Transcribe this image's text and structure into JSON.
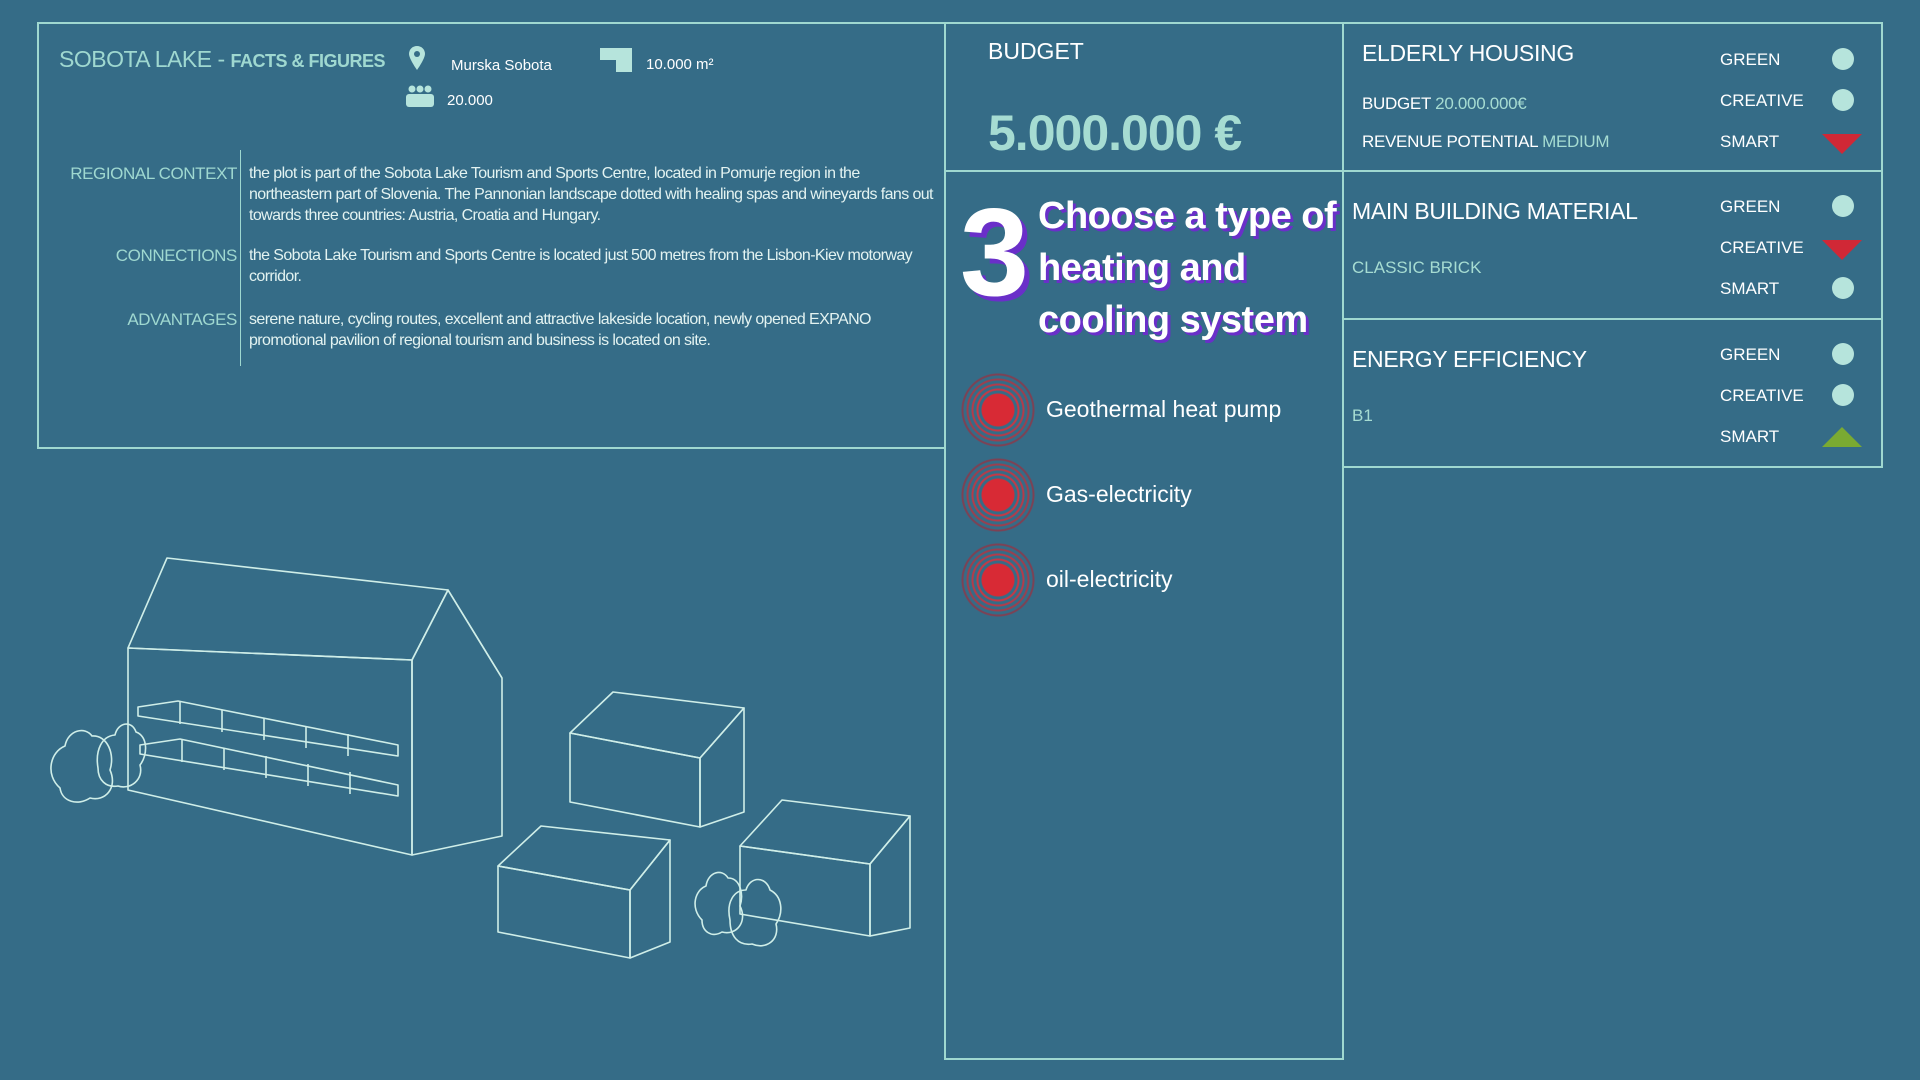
{
  "facts": {
    "title_main": "SOBOTA LAKE",
    "title_sep": " - ",
    "title_sub": "FACTS & FIGURES",
    "location": "Murska Sobota",
    "area": "10.000 m²",
    "population": "20.000",
    "rows": [
      {
        "label": "REGIONAL CONTEXT",
        "text": "the plot is part of the Sobota Lake Tourism and Sports Centre, located in Pomurje region in the northeastern part of Slovenia. The Pannonian landscape dotted with healing spas and wineyards fans out towards three countries: Austria, Croatia and Hungary."
      },
      {
        "label": "CONNECTIONS",
        "text": "the Sobota Lake Tourism and Sports Centre is located just 500 metres from the Lisbon-Kiev motorway corridor."
      },
      {
        "label": "ADVANTAGES",
        "text": "serene nature, cycling routes, excellent and attractive lakeside location, newly opened EXPANO promotional pavilion of regional tourism and business is located on site."
      }
    ]
  },
  "budget": {
    "label": "BUDGET",
    "value": "5.000.000 €"
  },
  "step": {
    "number": "3",
    "title": "Choose a type of heating and cooling system",
    "options": [
      "Geothermal heat pump",
      "Gas-electricity",
      "oil-electricity"
    ]
  },
  "housing": {
    "title": "ELDERLY HOUSING",
    "budget_label": "BUDGET",
    "budget_value": "20.000.000€",
    "revenue_label": "REVENUE POTENTIAL",
    "revenue_value": "MEDIUM",
    "indicators": [
      {
        "label": "GREEN",
        "state": "neutral"
      },
      {
        "label": "CREATIVE",
        "state": "neutral"
      },
      {
        "label": "SMART",
        "state": "down"
      }
    ]
  },
  "material": {
    "title": "MAIN BUILDING MATERIAL",
    "value": "CLASSIC BRICK",
    "indicators": [
      {
        "label": "GREEN",
        "state": "neutral"
      },
      {
        "label": "CREATIVE",
        "state": "down"
      },
      {
        "label": "SMART",
        "state": "neutral"
      }
    ]
  },
  "energy": {
    "title": "ENERGY EFFICIENCY",
    "value": "B1",
    "indicators": [
      {
        "label": "GREEN",
        "state": "neutral"
      },
      {
        "label": "CREATIVE",
        "state": "neutral"
      },
      {
        "label": "SMART",
        "state": "up"
      }
    ]
  },
  "colors": {
    "background": "#356c87",
    "accent": "#a6dcd2",
    "negative": "#d02836",
    "positive": "#7aaa32",
    "shadow": "#6a2fc9"
  }
}
